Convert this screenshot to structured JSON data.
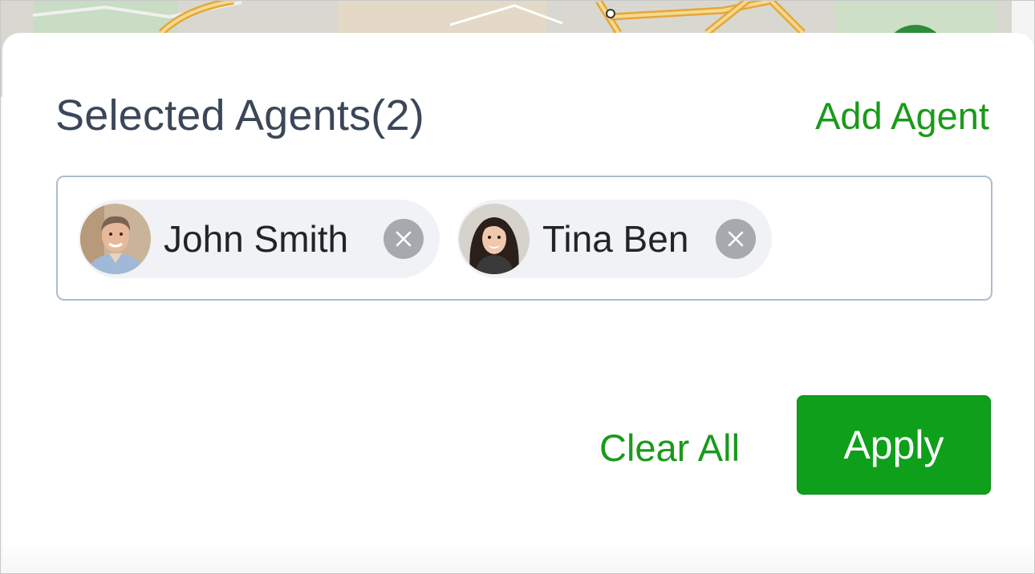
{
  "panel": {
    "title": "Selected Agents(2)",
    "add_agent_label": "Add Agent"
  },
  "agents": [
    {
      "name": "John Smith",
      "avatar_icon": "john-smith-avatar",
      "remove_icon": "close-icon"
    },
    {
      "name": "Tina Ben",
      "avatar_icon": "tina-ben-avatar",
      "remove_icon": "close-icon"
    }
  ],
  "actions": {
    "clear_all_label": "Clear All",
    "apply_label": "Apply"
  },
  "colors": {
    "accent_green": "#1a9a1a",
    "apply_bg": "#0ea01b",
    "title_text": "#3b4758",
    "chip_bg": "#f1f2f6",
    "remove_bg": "#a6a9ae",
    "box_border": "#aebccd"
  }
}
